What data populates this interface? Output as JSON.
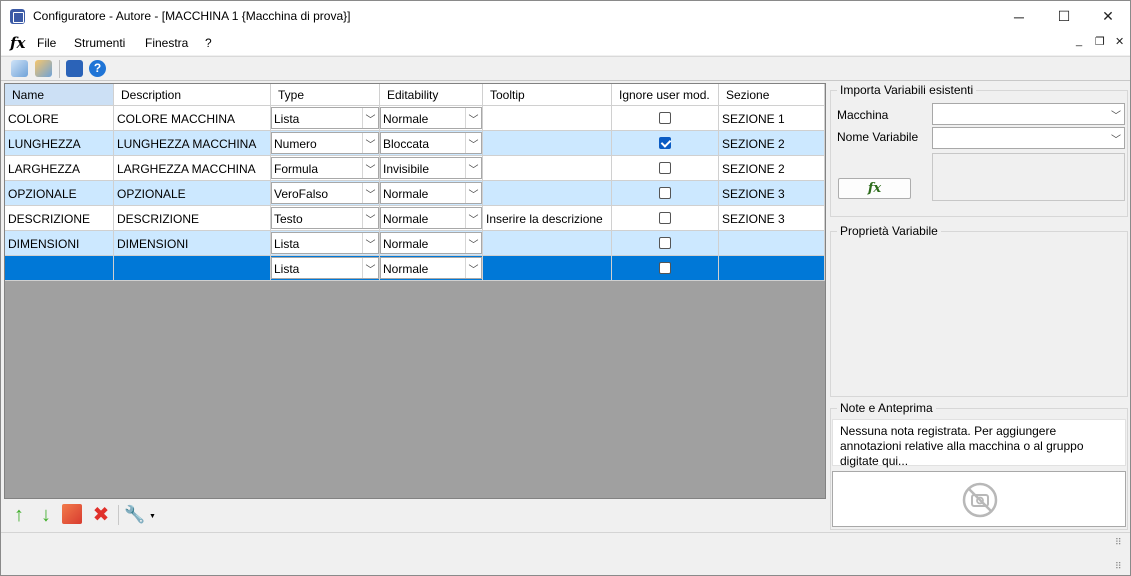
{
  "window": {
    "title": "Configuratore - Autore - [MACCHINA 1 {Macchina di prova}]",
    "minimize": "─",
    "maximize": "☐",
    "close": "✕"
  },
  "menu": {
    "logo": "fx",
    "items": [
      "File",
      "Strumenti",
      "Finestra",
      "?"
    ],
    "mdi_min": "_",
    "mdi_restore": "❐",
    "mdi_close": "✕"
  },
  "grid": {
    "columns": [
      "Name",
      "Description",
      "Type",
      "Editability",
      "Tooltip",
      "Ignore user mod.",
      "Sezione"
    ],
    "rows": [
      {
        "name": "COLORE",
        "description": "COLORE MACCHINA",
        "type": "Lista",
        "editability": "Normale",
        "tooltip": "",
        "ignore": false,
        "sezione": "SEZIONE 1"
      },
      {
        "name": "LUNGHEZZA",
        "description": "LUNGHEZZA MACCHINA",
        "type": "Numero",
        "editability": "Bloccata",
        "tooltip": "",
        "ignore": true,
        "sezione": "SEZIONE 2"
      },
      {
        "name": "LARGHEZZA",
        "description": "LARGHEZZA MACCHINA",
        "type": "Formula",
        "editability": "Invisibile",
        "tooltip": "",
        "ignore": false,
        "sezione": "SEZIONE 2"
      },
      {
        "name": "OPZIONALE",
        "description": "OPZIONALE",
        "type": "VeroFalso",
        "editability": "Normale",
        "tooltip": "",
        "ignore": false,
        "sezione": "SEZIONE 3"
      },
      {
        "name": "DESCRIZIONE",
        "description": "DESCRIZIONE",
        "type": "Testo",
        "editability": "Normale",
        "tooltip": "Inserire la descrizione",
        "ignore": false,
        "sezione": "SEZIONE 3"
      },
      {
        "name": "DIMENSIONI",
        "description": "DIMENSIONI",
        "type": "Lista",
        "editability": "Normale",
        "tooltip": "",
        "ignore": false,
        "sezione": ""
      },
      {
        "name": "",
        "description": "",
        "type": "Lista",
        "editability": "Normale",
        "tooltip": "",
        "ignore": false,
        "sezione": ""
      }
    ],
    "combo_arrow": "﹀"
  },
  "import_panel": {
    "title": "Importa Variabili esistenti",
    "macchina_label": "Macchina",
    "nome_variabile_label": "Nome Variabile",
    "macchina_value": "",
    "nome_variabile_value": "",
    "fx_button": "fx"
  },
  "properties_panel": {
    "title": "Proprietà Variabile"
  },
  "notes_panel": {
    "title": "Note e Anteprima",
    "notes_text": "Nessuna nota registrata. Per aggiungere annotazioni relative alla macchina o al gruppo digitate qui..."
  },
  "colors": {
    "row_alt": "#cce8ff",
    "row_selected": "#0078d7",
    "header_selected": "#cce0f5",
    "grid_empty": "#a0a0a0"
  }
}
